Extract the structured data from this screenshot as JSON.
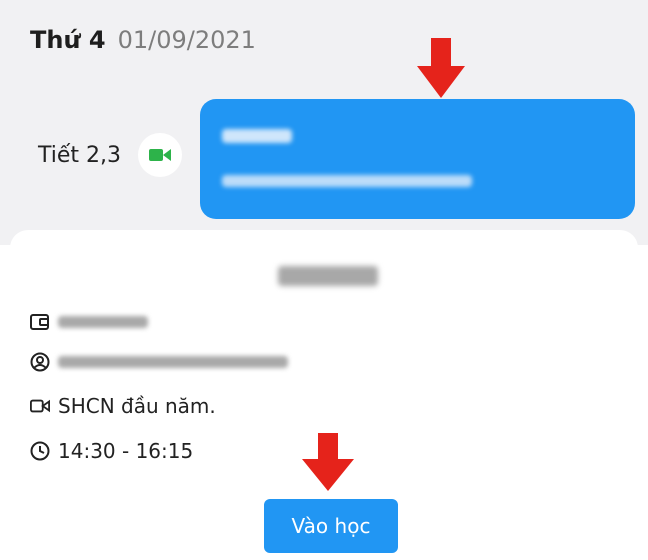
{
  "schedule": {
    "day": "Thứ 4",
    "date": "01/09/2021",
    "period_label": "Tiết 2,3"
  },
  "detail": {
    "meeting_title": "SHCN đầu năm.",
    "time_range": "14:30 - 16:15",
    "join_label": "Vào học"
  },
  "colors": {
    "accent": "#2196f3",
    "arrow": "#e5231b",
    "video_icon": "#2db34a"
  },
  "icons": [
    "video-camera-icon",
    "red-arrow-down",
    "wallet-icon",
    "user-circle-icon",
    "clock-icon"
  ]
}
